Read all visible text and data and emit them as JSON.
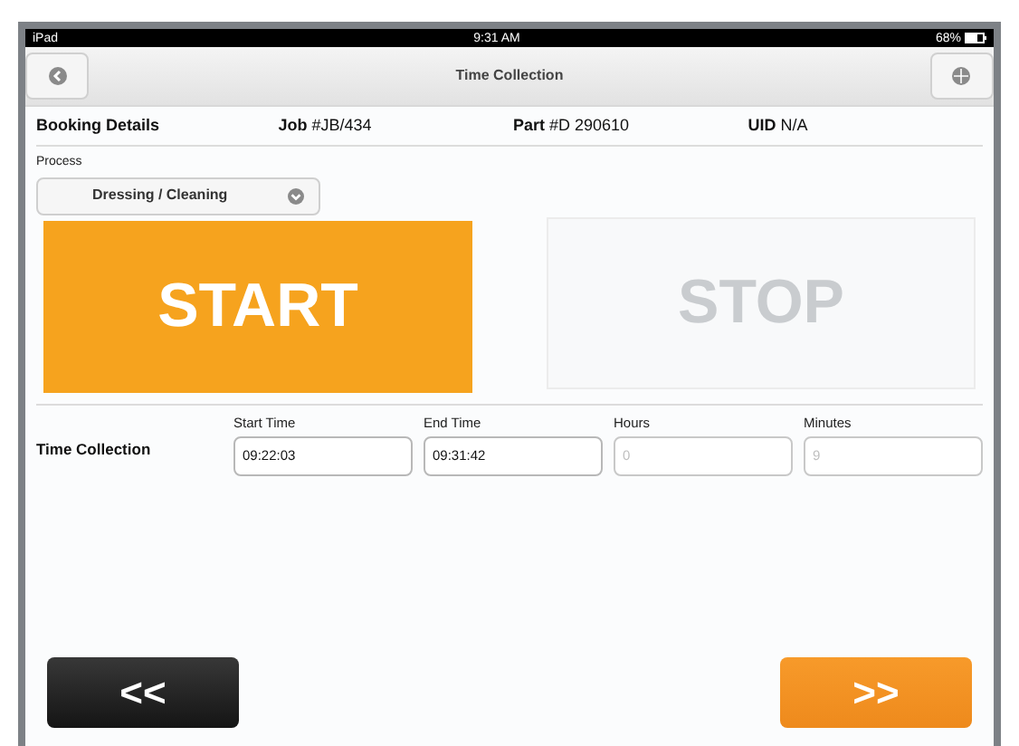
{
  "status_bar": {
    "device": "iPad",
    "time": "9:31 AM",
    "battery": "68%"
  },
  "nav_bar": {
    "title": "Time Collection"
  },
  "booking": {
    "heading": "Booking Details",
    "fields": [
      "**Job** #JB/434",
      "**Part** #D 290610",
      "**UID** N/A"
    ]
  },
  "process": {
    "label": "Process",
    "value": "Dressing / Cleaning"
  },
  "actions": [
    {
      "label": "START",
      "disabled": false
    },
    {
      "label": "STOP",
      "disabled": true
    }
  ],
  "time_collection": {
    "heading": "Time Collection",
    "fields": [
      {
        "label": "Start Time",
        "value": "09:22:03",
        "disabled": false
      },
      {
        "label": "End Time",
        "value": "09:31:42",
        "disabled": false
      },
      {
        "label": "Hours",
        "value": "0",
        "disabled": true
      },
      {
        "label": "Minutes",
        "value": "9",
        "disabled": true
      }
    ]
  },
  "footer": {
    "back": "<<",
    "next": ">>"
  }
}
